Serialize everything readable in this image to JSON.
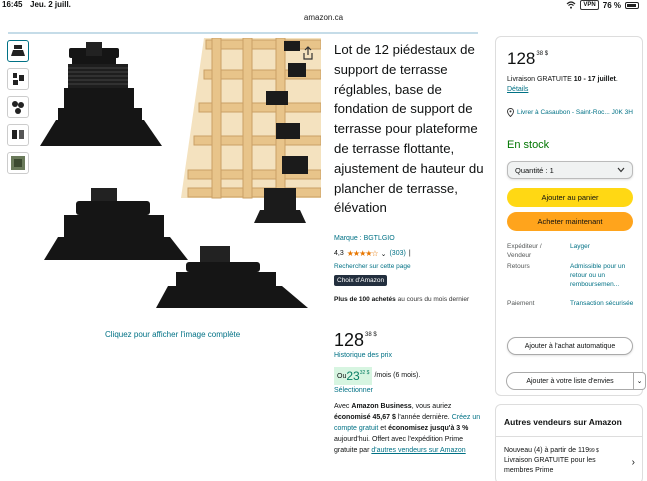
{
  "status_bar": {
    "time": "16:45",
    "date": "Jeu. 2 juill.",
    "vpn": "VPN",
    "battery": "76 %"
  },
  "browser": {
    "url": "amazon.ca"
  },
  "gallery": {
    "thumbnails": [
      "pedestal-thumb-1",
      "pedestal-thumb-2",
      "pedestal-thumb-3",
      "pedestal-thumb-4",
      "pedestal-thumb-5"
    ],
    "click_full_image": "Cliquez pour afficher l'image complète"
  },
  "product": {
    "title": "Lot de 12 piédestaux de support de terrasse réglables, base de fondation de support de terrasse pour plateforme de terrasse flottante, ajustement de hauteur du plancher de terrasse, élévation",
    "brand": "Marque : BGTLGIO",
    "rating_value": "4,3",
    "stars": "★★★★☆",
    "rating_chevron": "⌄",
    "rating_count": "(303)",
    "rating_sep": "|",
    "search_page": "Rechercher sur cette page",
    "choice_badge": "Choix d'Amazon",
    "bought_bold": "Plus de 100 achetés",
    "bought_rest": " au cours du mois dernier",
    "price_whole": "128",
    "price_sup": "38 $",
    "price_history": "Historique des prix",
    "monthly_prefix": "Ou ",
    "monthly_whole": "23",
    "monthly_sup": "32 $",
    "monthly_rest": "/mois (6 mois).",
    "select_link": "Sélectionner",
    "business_prefix": "Avec ",
    "business_bold": "Amazon Business",
    "business_mid": ", vous auriez ",
    "business_saved": "économisé 45,67 $",
    "business_year": " l'année dernière.",
    "business_create": "Créez un compte gratuit",
    "business_and": " et ",
    "business_save_pct": "économisez jusqu'à 3 %",
    "business_today": " aujourd'hui.",
    "business_prime": "Offert avec l'expédition Prime gratuite par ",
    "business_sellers": "d'autres vendeurs sur Amazon"
  },
  "buybox": {
    "price_whole": "128",
    "price_sup": "38 $",
    "delivery_prefix": "Livraison GRATUITE ",
    "delivery_dates": "10 - 17 juillet",
    "delivery_sep": ". ",
    "details_link": "Détails",
    "location": "Livrer à Casaubon - Saint-Roc... J0K 3H",
    "stock": "En stock",
    "quantity": "Quantité : 1",
    "add_to_cart": "Ajouter au panier",
    "buy_now": "Acheter maintenant",
    "shipper_label": "Expéditeur / Vendeur",
    "shipper_value": "Layger",
    "returns_label": "Retours",
    "returns_value": "Admissible pour un retour ou un remboursemen...",
    "payment_label": "Paiement",
    "payment_value": "Transaction sécurisée",
    "auto_buy": "Ajouter à l'achat automatique",
    "wishlist": "Ajouter à votre liste d'envies",
    "wishlist_chevron": "⌄"
  },
  "other_sellers": {
    "header": "Autres vendeurs sur Amazon",
    "new_text": "Nouveau (4) à partir de ",
    "new_price": "119",
    "new_price_sup": "99 $",
    "new_rest": " Livraison GRATUITE pour les membres Prime",
    "chevron": "›"
  },
  "colors": {
    "link": "#007185",
    "in_stock": "#007600",
    "add_to_cart": "#FFD814",
    "buy_now": "#FFA41C",
    "stars": "#E77600",
    "badge": "#232F3E"
  }
}
